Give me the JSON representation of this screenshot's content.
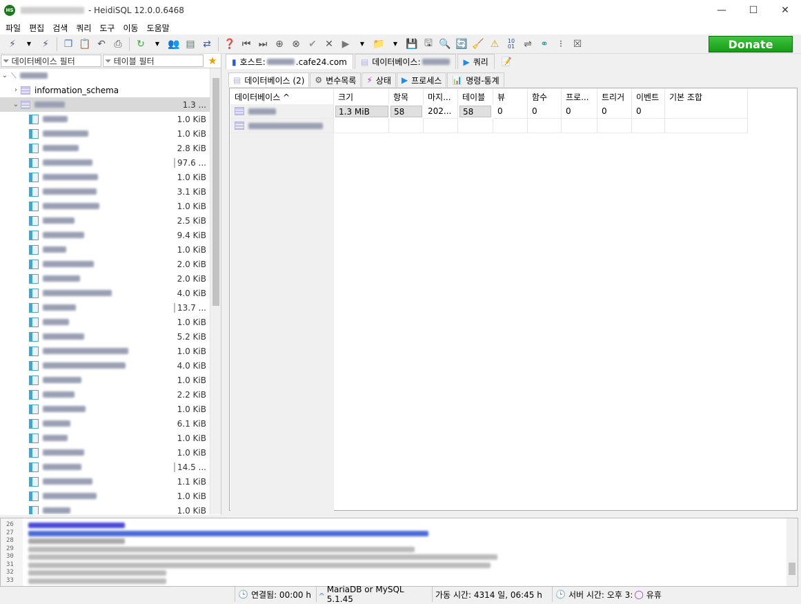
{
  "window": {
    "title": "- HeidiSQL 12.0.0.6468",
    "app_icon_text": "HS",
    "controls": {
      "minimize": "—",
      "maximize": "☐",
      "close": "✕"
    }
  },
  "menu": [
    "파일",
    "편집",
    "검색",
    "쿼리",
    "도구",
    "이동",
    "도움말"
  ],
  "toolbar": {
    "donate_label": "Donate"
  },
  "left": {
    "db_filter_placeholder": "데이터베이스 필터",
    "table_filter_placeholder": "테이블 필터",
    "tree": {
      "information_schema": "information_schema",
      "selected_db_size": "1.3 ...",
      "table_sizes": [
        "1.0 KiB",
        "1.0 KiB",
        "2.8 KiB",
        "97.6 ...",
        "1.0 KiB",
        "3.1 KiB",
        "1.0 KiB",
        "2.5 KiB",
        "9.4 KiB",
        "1.0 KiB",
        "2.0 KiB",
        "2.0 KiB",
        "4.0 KiB",
        "13.7 ...",
        "1.0 KiB",
        "5.2 KiB",
        "1.0 KiB",
        "4.0 KiB",
        "1.0 KiB",
        "2.2 KiB",
        "1.0 KiB",
        "6.1 KiB",
        "1.0 KiB",
        "1.0 KiB",
        "14.5 ...",
        "1.1 KiB",
        "1.0 KiB",
        "1.0 KiB"
      ]
    }
  },
  "tabs": {
    "host_label": "호스트:",
    "host_value": ".cafe24.com",
    "database_label": "데이터베이스:",
    "query_label": "쿼리"
  },
  "subtabs": {
    "databases": "데이터베이스 (2)",
    "variables": "변수목록",
    "status": "상태",
    "processes": "프로세스",
    "command_stats": "명령-통계"
  },
  "grid": {
    "headers": [
      "데이터베이스 ^",
      "크기",
      "항목",
      "마지...",
      "테이블",
      "뷰",
      "함수",
      "프로...",
      "트리거",
      "이벤트",
      "기본 조합"
    ],
    "row1": {
      "size": "1.3 MiB",
      "items": "58",
      "last": "202...",
      "tables": "58",
      "views": "0",
      "functions": "0",
      "procedures": "0",
      "triggers": "0",
      "events": "0"
    }
  },
  "log": {
    "line_numbers": [
      "26",
      "27",
      "28",
      "29",
      "30",
      "31",
      "32",
      "33"
    ]
  },
  "status": {
    "connected": "연결됨: 00:00 h",
    "server": "MariaDB or MySQL 5.1.45",
    "uptime": "가동 시간: 4314 일, 06:45 h",
    "server_time": "서버 시간: 오후 3:",
    "idle": "유휴"
  }
}
